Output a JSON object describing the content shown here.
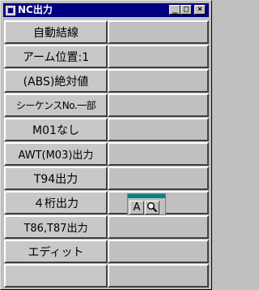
{
  "window": {
    "title": "NC出力",
    "controls": {
      "minimize": "_",
      "maximize": "□",
      "close": "×"
    }
  },
  "rows": [
    {
      "label": "自動結線",
      "value": ""
    },
    {
      "label": "アーム位置:1",
      "value": ""
    },
    {
      "label": "(ABS)絶対値",
      "value": ""
    },
    {
      "label": "シーケンスNo.一部",
      "value": ""
    },
    {
      "label": "M01なし",
      "value": ""
    },
    {
      "label": "AWT(M03)出力",
      "value": ""
    },
    {
      "label": "T94出力",
      "value": ""
    },
    {
      "label": "４桁出力",
      "value": ""
    },
    {
      "label": "T86,T87出力",
      "value": ""
    },
    {
      "label": "エディット",
      "value": ""
    },
    {
      "label": "",
      "value": ""
    }
  ],
  "mini_toolbar": {
    "tool_a": "A",
    "tool_search": "🔍",
    "icons": [
      "text-a-icon",
      "magnifier-icon"
    ]
  },
  "colors": {
    "titlebar": "#000080",
    "face": "#c0c0c0",
    "toolbar_stripe": "#0f8080"
  }
}
